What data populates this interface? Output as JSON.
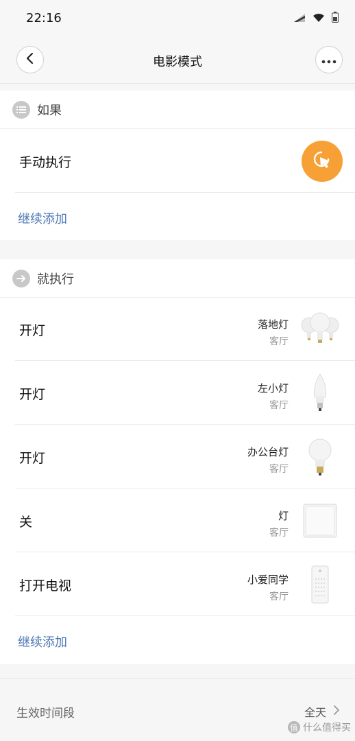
{
  "status_bar": {
    "time": "22:16"
  },
  "nav": {
    "title": "电影模式"
  },
  "if_section": {
    "label": "如果",
    "trigger": "手动执行",
    "add_label": "继续添加"
  },
  "then_section": {
    "label": "就执行",
    "actions": [
      {
        "action": "开灯",
        "device": "落地灯",
        "room": "客厅",
        "image": "bulb-cluster"
      },
      {
        "action": "开灯",
        "device": "左小灯",
        "room": "客厅",
        "image": "candle-bulb"
      },
      {
        "action": "开灯",
        "device": "办公台灯",
        "room": "客厅",
        "image": "bulb"
      },
      {
        "action": "关",
        "device": "灯",
        "room": "客厅",
        "image": "wall-switch"
      },
      {
        "action": "打开电视",
        "device": "小爱同学",
        "room": "客厅",
        "image": "smart-speaker"
      }
    ],
    "add_label": "继续添加"
  },
  "effective_period": {
    "label": "生效时间段",
    "value": "全天"
  },
  "watermark": {
    "text": "什么值得买",
    "badge": "值"
  },
  "colors": {
    "accent_orange": "#f7a035",
    "link_blue": "#4b76b4"
  }
}
